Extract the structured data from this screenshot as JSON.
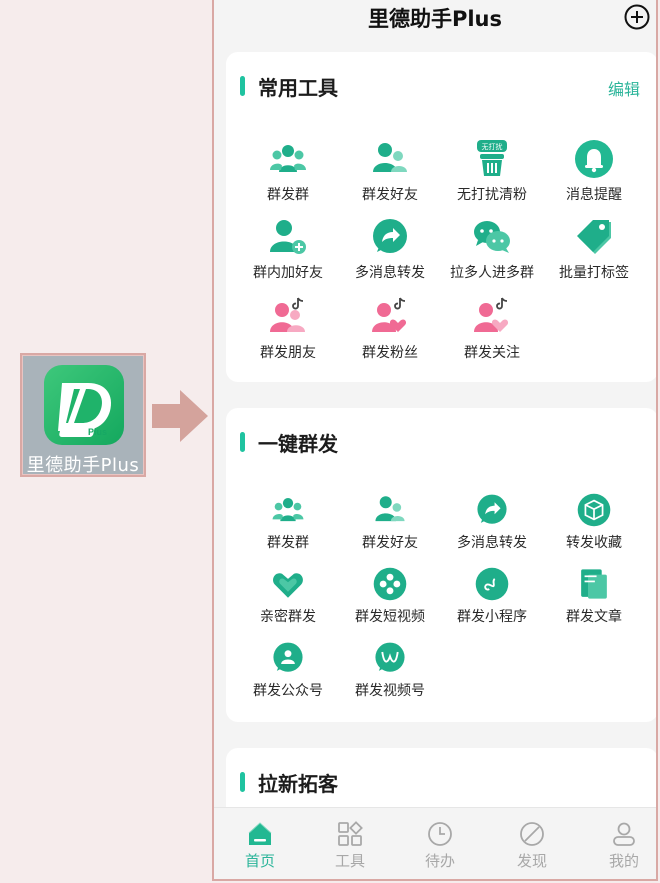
{
  "app_icon": {
    "label": "里德助手Plus",
    "badge": "Plus"
  },
  "title": "里德助手Plus",
  "colors": {
    "accent": "#2bb59a",
    "icon_green": "#22b892",
    "icon_pink": "#f06a94"
  },
  "sections": {
    "common": {
      "title": "常用工具",
      "edit": "编辑",
      "items": [
        {
          "label": "群发群",
          "icon": "group-icon"
        },
        {
          "label": "群发好友",
          "icon": "friends-icon"
        },
        {
          "label": "无打扰清粉",
          "icon": "no-disturb-clean-icon",
          "badge": "无打扰"
        },
        {
          "label": "消息提醒",
          "icon": "bell-icon"
        },
        {
          "label": "群内加好友",
          "icon": "add-user-icon"
        },
        {
          "label": "多消息转发",
          "icon": "forward-icon"
        },
        {
          "label": "拉多人进多群",
          "icon": "chat-bubbles-icon"
        },
        {
          "label": "批量打标签",
          "icon": "tag-icon"
        },
        {
          "label": "群发朋友",
          "icon": "tiktok-friends-icon"
        },
        {
          "label": "群发粉丝",
          "icon": "tiktok-fans-icon"
        },
        {
          "label": "群发关注",
          "icon": "tiktok-follow-icon"
        }
      ]
    },
    "broadcast": {
      "title": "一键群发",
      "items": [
        {
          "label": "群发群",
          "icon": "group-icon"
        },
        {
          "label": "群发好友",
          "icon": "friends-icon"
        },
        {
          "label": "多消息转发",
          "icon": "forward-icon"
        },
        {
          "label": "转发收藏",
          "icon": "cube-icon"
        },
        {
          "label": "亲密群发",
          "icon": "heart-icon"
        },
        {
          "label": "群发短视频",
          "icon": "film-reel-icon"
        },
        {
          "label": "群发小程序",
          "icon": "mini-program-icon"
        },
        {
          "label": "群发文章",
          "icon": "article-icon"
        },
        {
          "label": "群发公众号",
          "icon": "official-account-icon"
        },
        {
          "label": "群发视频号",
          "icon": "channels-icon"
        }
      ]
    },
    "acquire": {
      "title": "拉新拓客"
    }
  },
  "tabs": [
    {
      "label": "首页",
      "icon": "home-icon",
      "active": true
    },
    {
      "label": "工具",
      "icon": "tools-icon",
      "active": false
    },
    {
      "label": "待办",
      "icon": "clock-icon",
      "active": false
    },
    {
      "label": "发现",
      "icon": "compass-icon",
      "active": false
    },
    {
      "label": "我的",
      "icon": "profile-icon",
      "active": false
    }
  ]
}
